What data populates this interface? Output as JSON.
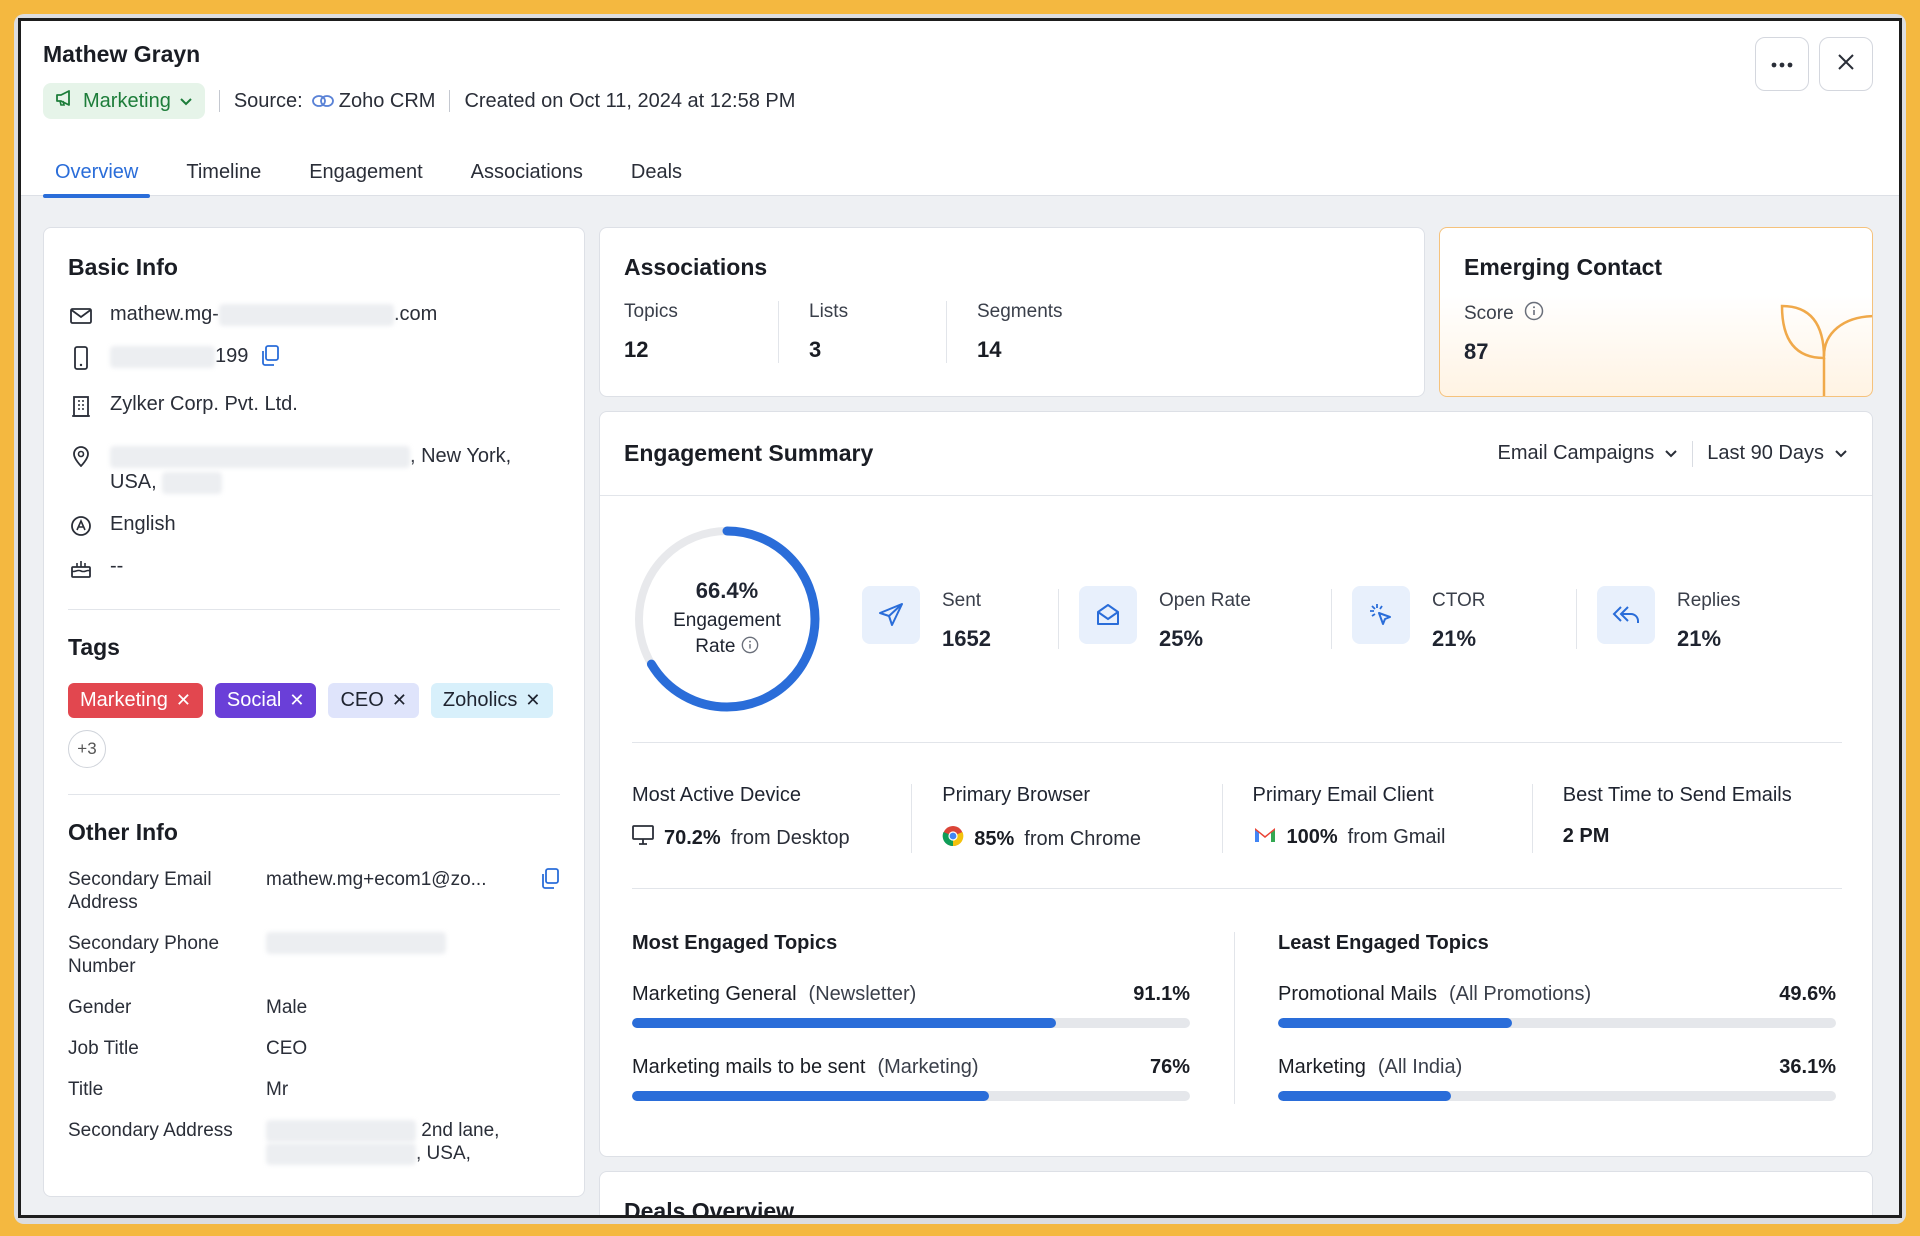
{
  "contact": {
    "name": "Mathew Grayn",
    "status": "Marketing",
    "source_label": "Source:",
    "source_value": "Zoho CRM",
    "created": "Created on Oct 11, 2024 at 12:58 PM"
  },
  "tabs": [
    "Overview",
    "Timeline",
    "Engagement",
    "Associations",
    "Deals"
  ],
  "basic_info": {
    "title": "Basic Info",
    "email_prefix": "mathew.mg-",
    "email_suffix": ".com",
    "phone_suffix": "199",
    "company": "Zylker Corp. Pvt. Ltd.",
    "address_line1_suffix": ", New York,",
    "address_line2_prefix": "USA,",
    "language": "English",
    "birthday": "--"
  },
  "tags": {
    "title": "Tags",
    "items": [
      {
        "label": "Marketing",
        "bg": "#e2474f",
        "fg": "#ffffff"
      },
      {
        "label": "Social",
        "bg": "#6a3fd8",
        "fg": "#ffffff"
      },
      {
        "label": "CEO",
        "bg": "#dfe4fb",
        "fg": "#1f2430"
      },
      {
        "label": "Zoholics",
        "bg": "#d8f0fb",
        "fg": "#1f2430"
      }
    ],
    "more": "+3"
  },
  "other_info": {
    "title": "Other Info",
    "secondary_email_label": "Secondary Email Address",
    "secondary_email_value": "mathew.mg+ecom1@zo...",
    "secondary_phone_label": "Secondary Phone Number",
    "gender_label": "Gender",
    "gender_value": "Male",
    "job_title_label": "Job Title",
    "job_title_value": "CEO",
    "title_label": "Title",
    "title_value": "Mr",
    "secondary_address_label": "Secondary Address",
    "secondary_address_line1": "2nd lane,",
    "secondary_address_line2": ", USA,"
  },
  "associations": {
    "title": "Associations",
    "stats": [
      {
        "label": "Topics",
        "value": "12"
      },
      {
        "label": "Lists",
        "value": "3"
      },
      {
        "label": "Segments",
        "value": "14"
      }
    ]
  },
  "emerging": {
    "title": "Emerging Contact",
    "score_label": "Score",
    "score_value": "87"
  },
  "engagement": {
    "title": "Engagement Summary",
    "filter_campaign": "Email Campaigns",
    "filter_period": "Last 90 Days",
    "rate_value": "66.4%",
    "rate_fraction": 0.664,
    "rate_label_1": "Engagement",
    "rate_label_2": "Rate",
    "kpis": [
      {
        "label": "Sent",
        "value": "1652",
        "icon": "send-icon"
      },
      {
        "label": "Open Rate",
        "value": "25%",
        "icon": "mail-open-icon"
      },
      {
        "label": "CTOR",
        "value": "21%",
        "icon": "click-icon"
      },
      {
        "label": "Replies",
        "value": "21%",
        "icon": "reply-all-icon"
      }
    ],
    "insights": {
      "device_label": "Most Active Device",
      "device_pct": "70.2%",
      "device_text": "from Desktop",
      "browser_label": "Primary Browser",
      "browser_pct": "85%",
      "browser_text": "from Chrome",
      "client_label": "Primary Email Client",
      "client_pct": "100%",
      "client_text": "from Gmail",
      "time_label": "Best Time to Send Emails",
      "time_value": "2 PM"
    },
    "most_engaged": {
      "title": "Most Engaged Topics",
      "items": [
        {
          "name": "Marketing General",
          "category": "(Newsletter)",
          "pct": "91.1%",
          "fill": 0.76
        },
        {
          "name": "Marketing mails to be sent",
          "category": "(Marketing)",
          "pct": "76%",
          "fill": 0.64
        }
      ]
    },
    "least_engaged": {
      "title": "Least Engaged Topics",
      "items": [
        {
          "name": "Promotional Mails",
          "category": "(All Promotions)",
          "pct": "49.6%",
          "fill": 0.42
        },
        {
          "name": "Marketing",
          "category": "(All India)",
          "pct": "36.1%",
          "fill": 0.31
        }
      ]
    }
  },
  "next_card_title": "Deals Overview",
  "colors": {
    "accent": "#2a6dd9",
    "status_green": "#1d7d3a"
  }
}
